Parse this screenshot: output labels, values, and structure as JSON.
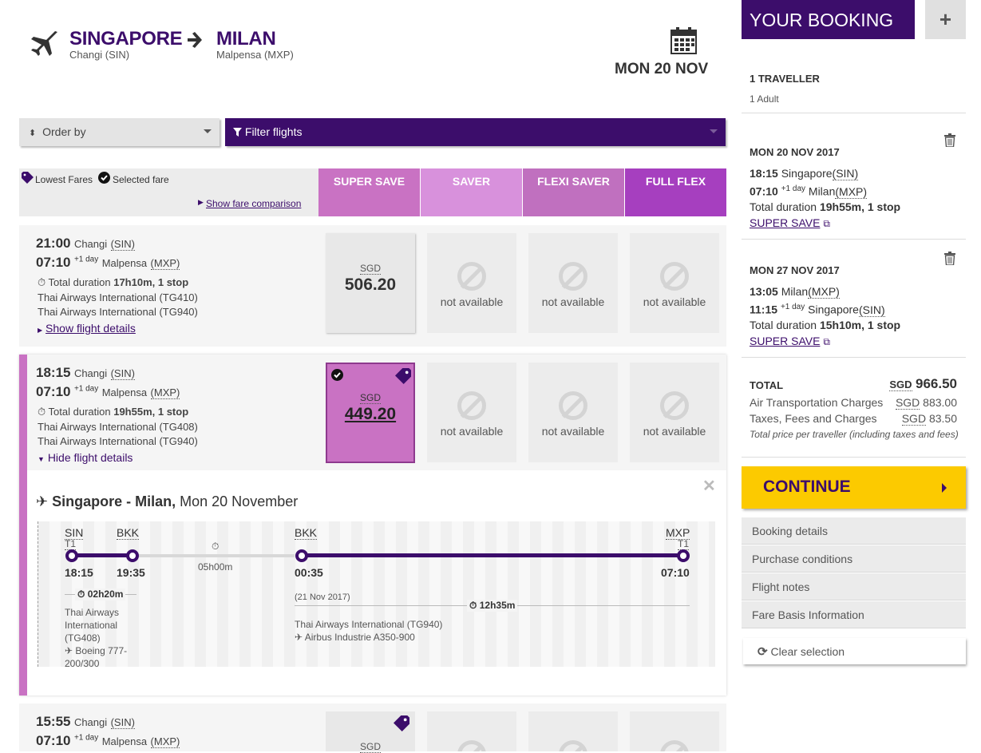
{
  "header": {
    "origin_city": "SINGAPORE",
    "origin_airport": "Changi (SIN)",
    "destination_city": "MILAN",
    "destination_airport": "Malpensa (MXP)",
    "date": "MON 20 NOV",
    "icons": [
      "plane-icon",
      "arrow-right-icon",
      "calendar-icon"
    ]
  },
  "toolbar": {
    "order_by": "Order by",
    "filter": "Filter flights"
  },
  "fare_header": {
    "lowest_fares": "Lowest Fares",
    "selected_fare": "Selected fare",
    "show_comparison": "Show fare comparison",
    "columns": [
      {
        "label": "SUPER SAVE",
        "color": "#c972c3"
      },
      {
        "label": "SAVER",
        "color": "#d891dc"
      },
      {
        "label": "FLEXI SAVER",
        "color": "#c070bf"
      },
      {
        "label": "FULL FLEX",
        "color": "#a63fbf"
      }
    ]
  },
  "flights": [
    {
      "dep_time": "21:00",
      "dep_airport": "Changi",
      "dep_code": "(SIN)",
      "arr_time": "07:10",
      "arr_day": "+1 day",
      "arr_airport": "Malpensa",
      "arr_code": "(MXP)",
      "duration_label": "Total duration",
      "duration": "17h10m, 1 stop",
      "legs": [
        "Thai Airways International (TG410)",
        "Thai Airways International (TG940)"
      ],
      "details_link": "Show flight details",
      "currency": "SGD",
      "price": "506.20",
      "na": [
        "not available",
        "not available",
        "not available"
      ]
    },
    {
      "dep_time": "18:15",
      "dep_airport": "Changi",
      "dep_code": "(SIN)",
      "arr_time": "07:10",
      "arr_day": "+1 day",
      "arr_airport": "Malpensa",
      "arr_code": "(MXP)",
      "duration_label": "Total duration",
      "duration": "19h55m, 1 stop",
      "legs": [
        "Thai Airways International (TG408)",
        "Thai Airways International (TG940)"
      ],
      "details_link": "Hide flight details",
      "currency": "SGD",
      "price": "449.20",
      "na": [
        "not available",
        "not available",
        "not available"
      ]
    },
    {
      "dep_time": "15:55",
      "dep_airport": "Changi",
      "dep_code": "(SIN)",
      "arr_time": "07:10",
      "arr_day": "+1 day",
      "arr_airport": "Malpensa",
      "arr_code": "(MXP)",
      "currency": "SGD"
    }
  ],
  "detail": {
    "route": "Singapore - Milan,",
    "date": "Mon 20 November",
    "seg1": {
      "from": "SIN",
      "from_term": "T1",
      "to": "BKK",
      "dep": "18:15",
      "arr": "19:35",
      "duration": "02h20m",
      "airline": "Thai Airways International (TG408)",
      "aircraft": "Boeing 777-200/300"
    },
    "layover": "05h00m",
    "seg2": {
      "from": "BKK",
      "to": "MXP",
      "to_term": "T1",
      "dep": "00:35",
      "arr": "07:10",
      "date": "(21 Nov 2017)",
      "duration": "12h35m",
      "airline": "Thai Airways International (TG940)",
      "aircraft": "Airbus Industrie A350-900"
    }
  },
  "booking": {
    "title": "YOUR BOOKING",
    "plus": "+",
    "travellers": "1 TRAVELLER",
    "travellers_sub": "1 Adult",
    "outbound": {
      "date": "MON 20 NOV 2017",
      "dep_time": "18:15",
      "dep_city": "Singapore",
      "dep_code": "(SIN)",
      "arr_time": "07:10",
      "arr_day": "+1 day",
      "arr_city": "Milan",
      "arr_code": "(MXP)",
      "duration_label": "Total duration",
      "duration": "19h55m, 1 stop",
      "fare": "SUPER SAVE"
    },
    "inbound": {
      "date": "MON 27 NOV 2017",
      "dep_time": "13:05",
      "dep_city": "Milan",
      "dep_code": "(MXP)",
      "arr_time": "11:15",
      "arr_day": "+1 day",
      "arr_city": "Singapore",
      "arr_code": "(SIN)",
      "duration_label": "Total duration",
      "duration": "15h10m, 1 stop",
      "fare": "SUPER SAVE"
    },
    "total_label": "TOTAL",
    "total_currency": "SGD",
    "total": "966.50",
    "air_label": "Air Transportation Charges",
    "air_currency": "SGD",
    "air": "883.00",
    "tax_label": "Taxes, Fees and Charges",
    "tax_currency": "SGD",
    "tax": "83.50",
    "note": "Total price per traveller (including taxes and fees)",
    "continue": "CONTINUE",
    "tabs": [
      "Booking details",
      "Purchase conditions",
      "Flight notes",
      "Fare Basis Information"
    ],
    "clear": "Clear selection"
  }
}
